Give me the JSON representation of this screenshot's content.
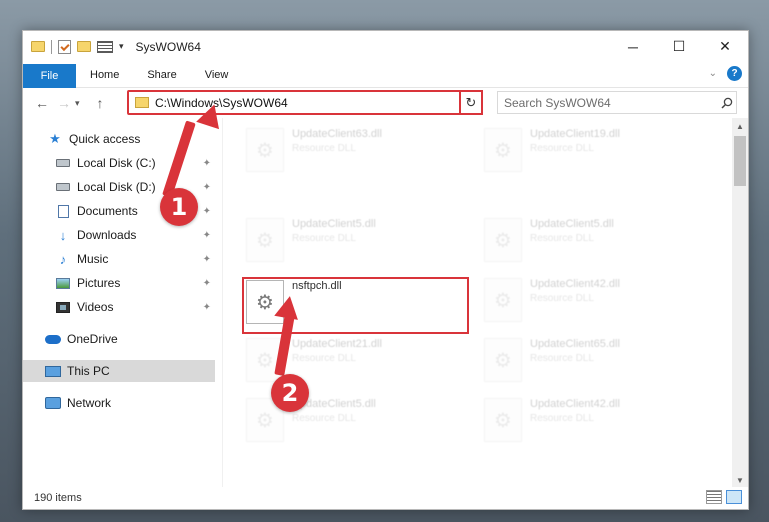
{
  "window": {
    "title": "SysWOW64"
  },
  "ribbon": {
    "file_tab": "File",
    "tabs": [
      "Home",
      "Share",
      "View"
    ],
    "help_label": "?"
  },
  "nav": {
    "back_glyph": "←",
    "forward_glyph": "→",
    "recent_glyph": "▾",
    "up_glyph": "↑",
    "address_path": "C:\\Windows\\SysWOW64",
    "address_dropdown_glyph": "⌄",
    "refresh_glyph": "↻",
    "search_placeholder": "Search SysWOW64"
  },
  "sidebar": {
    "items": [
      {
        "label": "Quick access",
        "icon": "star-icon",
        "pinned": false
      },
      {
        "label": "Local Disk (C:)",
        "icon": "drive-icon",
        "pinned": true
      },
      {
        "label": "Local Disk (D:)",
        "icon": "drive-icon",
        "pinned": true
      },
      {
        "label": "Documents",
        "icon": "documents-icon",
        "pinned": true
      },
      {
        "label": "Downloads",
        "icon": "downloads-icon",
        "pinned": true
      },
      {
        "label": "Music",
        "icon": "music-icon",
        "pinned": true
      },
      {
        "label": "Pictures",
        "icon": "pictures-icon",
        "pinned": true
      },
      {
        "label": "Videos",
        "icon": "videos-icon",
        "pinned": true
      },
      {
        "label": "OneDrive",
        "icon": "onedrive-icon",
        "pinned": false
      },
      {
        "label": "This PC",
        "icon": "this-pc-icon",
        "pinned": false,
        "selected": true
      },
      {
        "label": "Network",
        "icon": "network-icon",
        "pinned": false
      }
    ],
    "pin_glyph": "📌"
  },
  "files": [
    {
      "name": "UpdateClient63.dll",
      "type": "Resource DLL",
      "faded": true
    },
    {
      "name": "UpdateClient19.dll",
      "type": "Resource DLL",
      "faded": true
    },
    {
      "name": "UpdateClient5.dll",
      "type": "Resource DLL",
      "faded": true
    },
    {
      "name": "UpdateClient5.dll",
      "type": "Resource DLL",
      "faded": true
    },
    {
      "name": "nsftpch.dll",
      "type": "",
      "faded": false
    },
    {
      "name": "UpdateClient42.dll",
      "type": "Resource DLL",
      "faded": true
    },
    {
      "name": "UpdateClient21.dll",
      "type": "Resource DLL",
      "faded": true
    },
    {
      "name": "UpdateClient65.dll",
      "type": "Resource DLL",
      "faded": true
    },
    {
      "name": "UpdateClient5.dll",
      "type": "Resource DLL",
      "faded": true
    },
    {
      "name": "UpdateClient42.dll",
      "type": "Resource DLL",
      "faded": true
    }
  ],
  "status": {
    "item_count": "190 items"
  },
  "annotations": {
    "step1": "1",
    "step2": "2"
  },
  "colors": {
    "accent": "#1979ca",
    "annotation_red": "#d9343a",
    "selected_bg": "#d9d9d9"
  }
}
